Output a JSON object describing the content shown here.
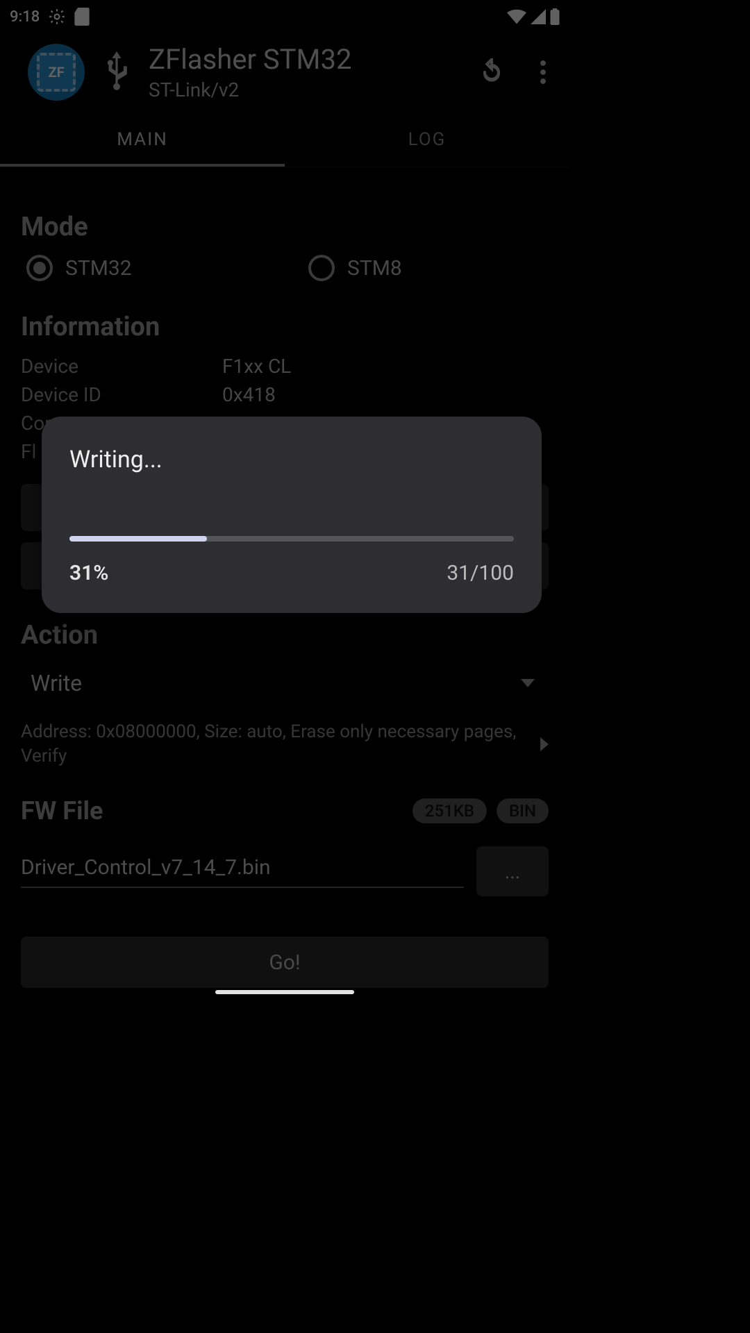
{
  "status": {
    "time": "9:18"
  },
  "header": {
    "title": "ZFlasher STM32",
    "subtitle": "ST-Link/v2",
    "logo_text": "ZF"
  },
  "tabs": {
    "main": "MAIN",
    "log": "LOG"
  },
  "mode": {
    "heading": "Mode",
    "stm32": "STM32",
    "stm8": "STM8"
  },
  "info": {
    "heading": "Information",
    "device_label": "Device",
    "device_value": "F1xx CL",
    "deviceid_label": "Device ID",
    "deviceid_value": "0x418",
    "core_label": "Core",
    "flash_label": "Fl"
  },
  "action": {
    "heading": "Action",
    "selected": "Write",
    "details": "Address: 0x08000000, Size: auto, Erase only necessary pages, Verify"
  },
  "fwfile": {
    "heading": "FW File",
    "size_pill": "251KB",
    "type_pill": "BIN",
    "filename": "Driver_Control_v7_14_7.bin",
    "browse": "...",
    "go": "Go!"
  },
  "dialog": {
    "title": "Writing...",
    "percent_label": "31%",
    "count_label": "31/100",
    "percent_value": 31
  }
}
